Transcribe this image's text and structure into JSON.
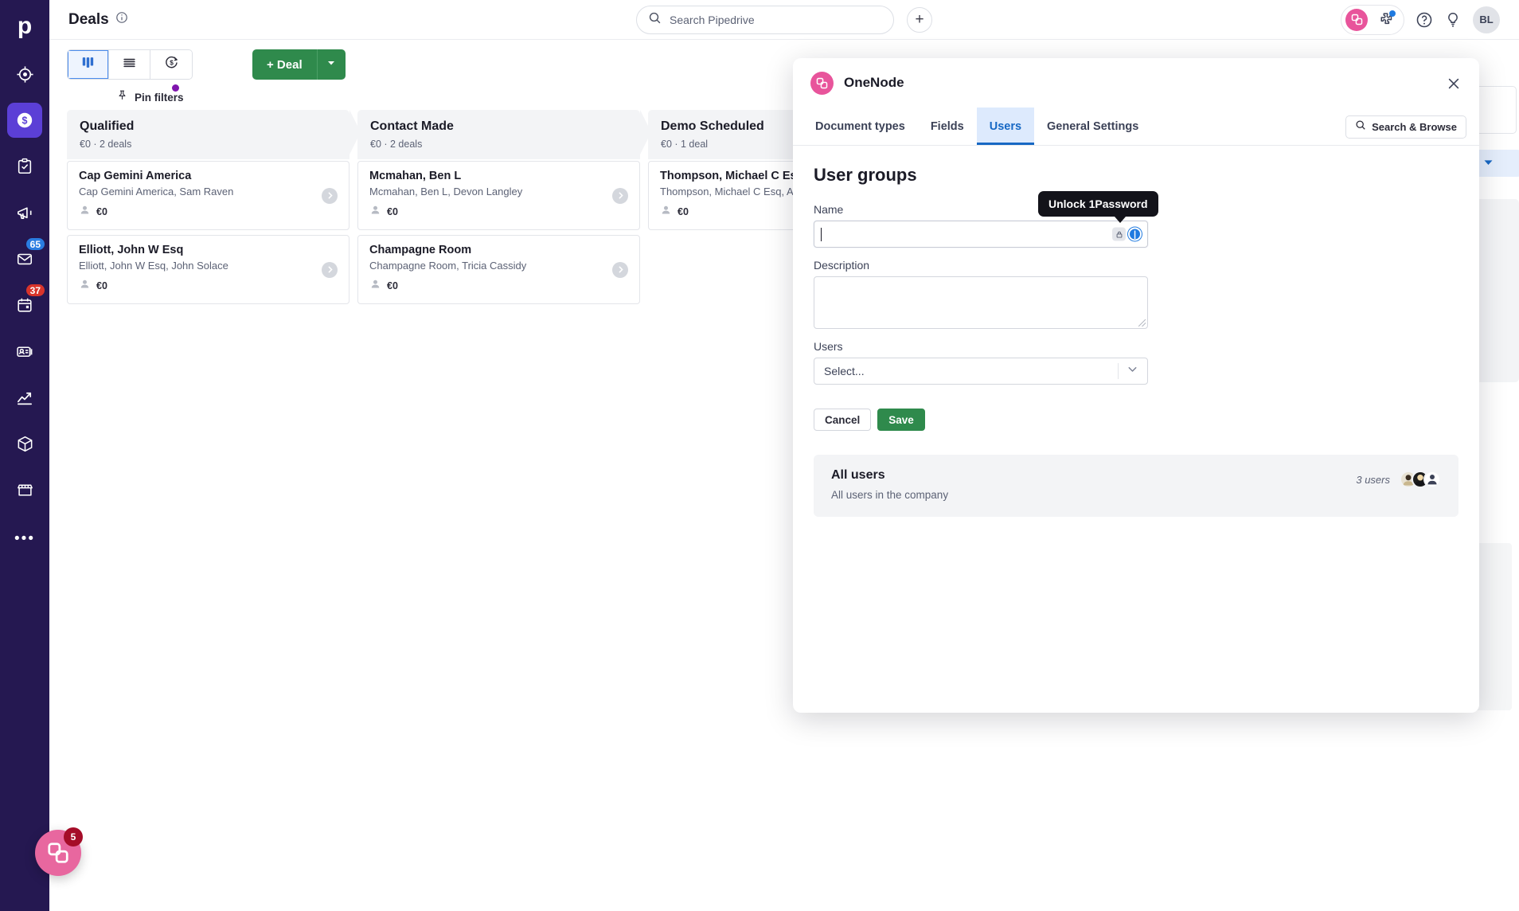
{
  "sidebar": {
    "logo": "p",
    "items": [
      {
        "name": "leads-inbox",
        "icon": "target-icon",
        "label": "Leads Inbox",
        "badge": null,
        "active": false
      },
      {
        "name": "deals",
        "icon": "deals-dollar-icon",
        "label": "Deals",
        "badge": null,
        "active": true
      },
      {
        "name": "activities",
        "icon": "clipboard-check-icon",
        "label": "Activities",
        "badge": null,
        "active": false
      },
      {
        "name": "campaigns",
        "icon": "megaphone-icon",
        "label": "Campaigns",
        "badge": null,
        "active": false
      },
      {
        "name": "mail",
        "icon": "envelope-icon",
        "label": "Mail",
        "badge": "65",
        "badge_color": "blue",
        "active": false
      },
      {
        "name": "calendar",
        "icon": "calendar-icon",
        "label": "Calendar",
        "badge": "37",
        "badge_color": "red",
        "active": false
      },
      {
        "name": "contacts",
        "icon": "contacts-card-icon",
        "label": "Contacts",
        "badge": null,
        "active": false
      },
      {
        "name": "insights",
        "icon": "chart-line-icon",
        "label": "Insights",
        "badge": null,
        "active": false
      },
      {
        "name": "products",
        "icon": "box-icon",
        "label": "Products",
        "badge": null,
        "active": false
      },
      {
        "name": "marketplace",
        "icon": "storefront-icon",
        "label": "Marketplace",
        "badge": null,
        "active": false
      }
    ],
    "more_label": "•••"
  },
  "topbar": {
    "page_title": "Deals",
    "info_icon": "info-circle-icon",
    "search": {
      "placeholder": "Search Pipedrive",
      "icon": "search-icon"
    },
    "add_button": "+",
    "right_icons": [
      {
        "name": "onenode-chip-icon",
        "label": "OneNode"
      },
      {
        "name": "puzzle-extension-icon",
        "label": "Extensions",
        "dot": true
      },
      {
        "name": "help-question-icon",
        "label": "Help"
      },
      {
        "name": "lightbulb-icon",
        "label": "What's new"
      }
    ],
    "avatar_initials": "BL"
  },
  "toolbar": {
    "views": [
      {
        "name": "pipeline-view",
        "icon": "kanban-icon",
        "active": true
      },
      {
        "name": "list-view",
        "icon": "list-icon",
        "active": false
      },
      {
        "name": "forecast-view",
        "icon": "forecast-dollar-icon",
        "active": false
      }
    ],
    "deal_button": "+ Deal",
    "deal_caret_icon": "chevron-down-icon",
    "pin_filters": "Pin filters",
    "pin_icon": "pin-icon"
  },
  "board": {
    "columns": [
      {
        "title": "Qualified",
        "summary": "€0 · 2 deals",
        "deals": [
          {
            "name": "Cap Gemini America",
            "org": "Cap Gemini America, Sam Raven",
            "value": "€0"
          },
          {
            "name": "Elliott, John W Esq",
            "org": "Elliott, John W Esq, John Solace",
            "value": "€0"
          }
        ]
      },
      {
        "title": "Contact Made",
        "summary": "€0 · 2 deals",
        "deals": [
          {
            "name": "Mcmahan, Ben L",
            "org": "Mcmahan, Ben L, Devon Langley",
            "value": "€0"
          },
          {
            "name": "Champagne Room",
            "org": "Champagne Room, Tricia Cassidy",
            "value": "€0"
          }
        ]
      },
      {
        "title": "Demo Scheduled",
        "summary": "€0 · 1 deal",
        "deals": [
          {
            "name": "Thompson, Michael C Esq",
            "org": "Thompson, Michael C Esq, A",
            "value": "€0"
          }
        ]
      }
    ]
  },
  "modal": {
    "title": "OneNode",
    "logo_icon": "onenode-logo-icon",
    "close_icon": "close-icon",
    "tabs": [
      {
        "label": "Document types",
        "active": false
      },
      {
        "label": "Fields",
        "active": false
      },
      {
        "label": "Users",
        "active": true
      },
      {
        "label": "General Settings",
        "active": false
      }
    ],
    "search_browse": {
      "label": "Search & Browse",
      "icon": "search-icon"
    },
    "section_title": "User groups",
    "form": {
      "name_label": "Name",
      "name_value": "",
      "description_label": "Description",
      "description_value": "",
      "users_label": "Users",
      "users_placeholder": "Select...",
      "users_caret_icon": "chevron-down-icon",
      "cancel_label": "Cancel",
      "save_label": "Save"
    },
    "tooltip": "Unlock 1Password",
    "onepassword": {
      "lock_icon": "lock-icon",
      "badge_icon": "onepassword-badge-icon"
    },
    "groups": [
      {
        "name": "All users",
        "description": "All users in the company",
        "count": "3 users"
      }
    ]
  },
  "launcher": {
    "icon": "onenode-logo-icon",
    "badge": "5"
  },
  "colors": {
    "sidebar_bg": "#251851",
    "accent_purple": "#5b3fd6",
    "green": "#2f8a4c",
    "pink": "#e8549b",
    "tab_active_bg": "#ddeafd",
    "tab_active_fg": "#1768c4",
    "badge_blue": "#2a7de1",
    "badge_red": "#d9342b"
  }
}
